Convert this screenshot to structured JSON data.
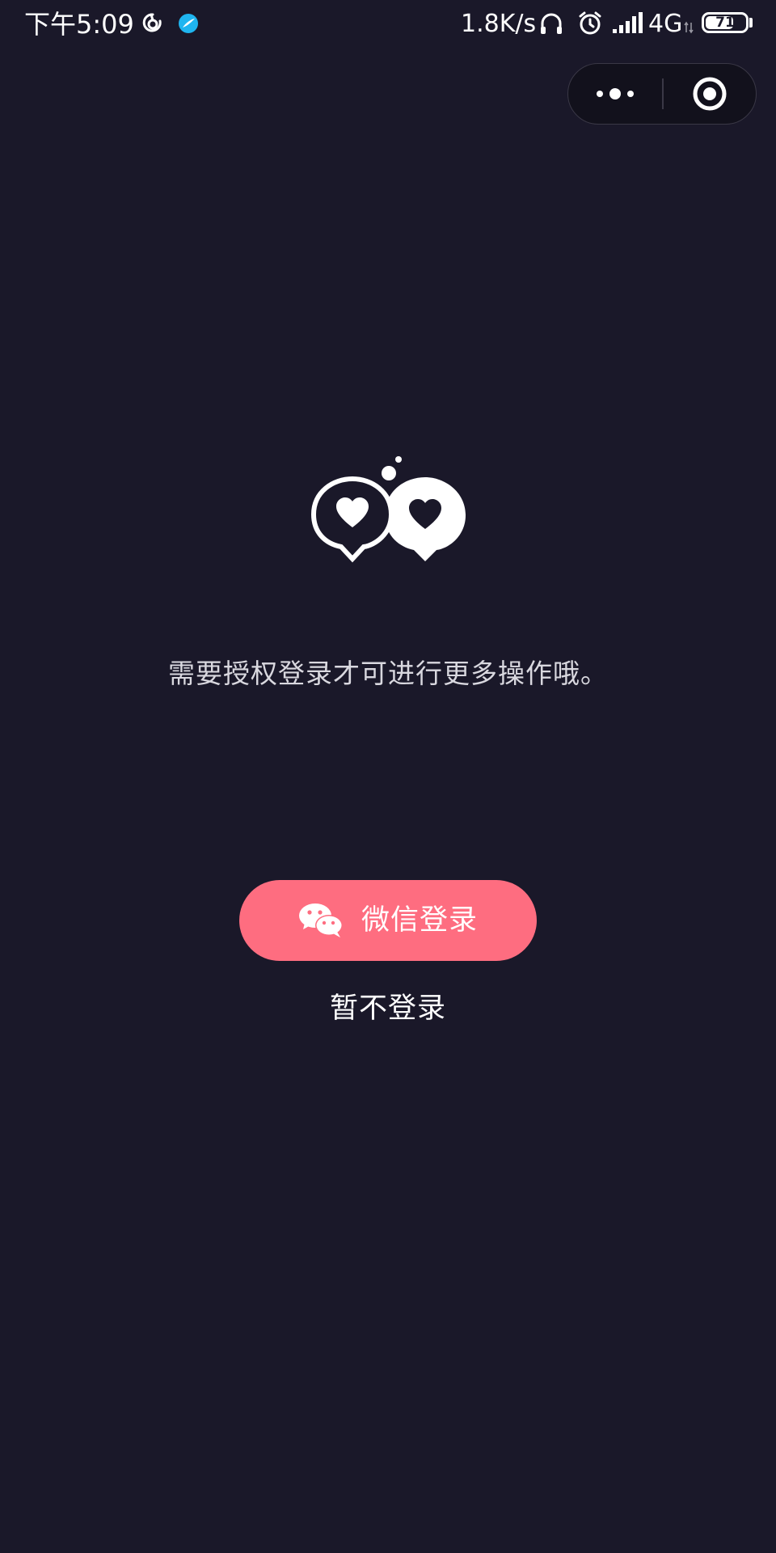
{
  "status_bar": {
    "time": "下午5:09",
    "net_speed": "1.8K/s",
    "network": "4G",
    "battery": "71",
    "battery_level": 0.71
  },
  "capsule": {
    "more_icon": "more-dots-icon",
    "close_icon": "target-icon"
  },
  "main": {
    "illustration_icon": "chat-hearts-icon",
    "message": "需要授权登录才可进行更多操作哦。",
    "wechat_login_label": "微信登录",
    "wechat_icon": "wechat-icon",
    "skip_label": "暂不登录"
  },
  "colors": {
    "background": "#1a1829",
    "accent": "#fe6d80",
    "text": "#ffffff"
  }
}
